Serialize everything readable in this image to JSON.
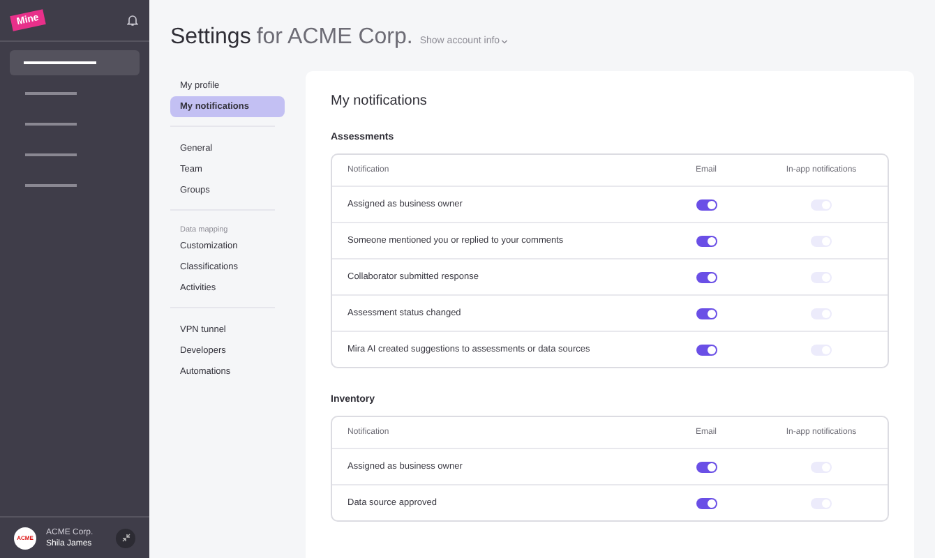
{
  "sidebar": {
    "logo": "Mine",
    "nav": [
      {
        "selected": true
      },
      {
        "selected": false
      },
      {
        "selected": false
      },
      {
        "selected": false
      },
      {
        "selected": false
      }
    ],
    "account": {
      "avatar": "ACME",
      "company": "ACME Corp.",
      "user": "Shila James"
    }
  },
  "header": {
    "title": "Settings",
    "subtitle": "for ACME Corp.",
    "link": "Show account info"
  },
  "menu": [
    {
      "items": [
        {
          "label": "My profile",
          "selected": false
        },
        {
          "label": "My notifications",
          "selected": true
        }
      ]
    },
    {
      "items": [
        {
          "label": "General",
          "selected": false
        },
        {
          "label": "Team",
          "selected": false
        },
        {
          "label": "Groups",
          "selected": false
        }
      ]
    },
    {
      "heading": "Data mapping",
      "items": [
        {
          "label": "Customization",
          "selected": false
        },
        {
          "label": "Classifications",
          "selected": false
        },
        {
          "label": "Activities",
          "selected": false
        }
      ]
    },
    {
      "items": [
        {
          "label": "VPN tunnel",
          "selected": false
        },
        {
          "label": "Developers",
          "selected": false
        },
        {
          "label": "Automations",
          "selected": false
        }
      ]
    }
  ],
  "panel": {
    "title": "My notifications",
    "sections": [
      {
        "title": "Assessments",
        "columns": [
          "Notification",
          "Email",
          "In-app notifications"
        ],
        "rows": [
          {
            "label": "Assigned as business owner",
            "email": true,
            "in_app": true,
            "in_app_disabled": true
          },
          {
            "label": "Someone mentioned you or replied to your comments",
            "email": true,
            "in_app": true,
            "in_app_disabled": true
          },
          {
            "label": "Collaborator submitted response",
            "email": true,
            "in_app": true,
            "in_app_disabled": true
          },
          {
            "label": "Assessment status changed",
            "email": true,
            "in_app": true,
            "in_app_disabled": true
          },
          {
            "label": "Mira AI created suggestions to assessments or data sources",
            "email": true,
            "in_app": true,
            "in_app_disabled": true
          }
        ]
      },
      {
        "title": "Inventory",
        "columns": [
          "Notification",
          "Email",
          "In-app notifications"
        ],
        "rows": [
          {
            "label": "Assigned as business owner",
            "email": true,
            "in_app": true,
            "in_app_disabled": true
          },
          {
            "label": "Data source approved",
            "email": true,
            "in_app": true,
            "in_app_disabled": true
          }
        ]
      }
    ]
  }
}
